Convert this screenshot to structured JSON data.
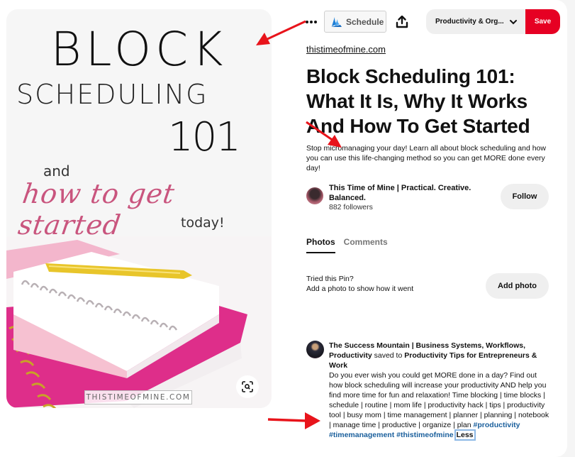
{
  "pin_image": {
    "title_line1": "BLOCK",
    "title_line2": "SCHEDULING",
    "title_line3": "101",
    "subtitle_and": "and",
    "subtitle_script": "how to get started",
    "subtitle_today": "today!",
    "watermark": "THISTIMEOFMINE.COM",
    "lens_icon": "visual-search-icon"
  },
  "toolbar": {
    "more_icon": "ellipsis-icon",
    "schedule_label": "Schedule",
    "share_icon": "share-upload-icon",
    "board_select_value": "Productivity & Org...",
    "save_label": "Save",
    "save_color": "#e60023"
  },
  "pin": {
    "source_link": "thistimeofmine.com",
    "title": "Block Scheduling 101: What It Is, Why It Works And How To Get Started",
    "description": "Stop micromanaging your day! Learn all about block scheduling and how you can use this life-changing method so you can get MORE done every day!"
  },
  "creator": {
    "name": "This Time of Mine | Practical. Creative. Balanced.",
    "followers": "882 followers",
    "follow_label": "Follow"
  },
  "tabs": [
    {
      "label": "Photos",
      "active": true
    },
    {
      "label": "Comments",
      "active": false
    }
  ],
  "tried": {
    "line1": "Tried this Pin?",
    "line2": "Add a photo to show how it went",
    "button_label": "Add photo"
  },
  "activity": {
    "user": "The Success Mountain | Business Systems, Workflows, Productivity",
    "action": "saved to",
    "board": "Productivity Tips for Entrepreneurs & Work",
    "text": "Do you ever wish you could get MORE done in a day? Find out how block scheduling will increase your productivity AND help you find more time for fun and relaxation! Time blocking | time blocks | schedule | routine | mom life | productivity hack | tips | productivity tool | busy mom | time management | planner | planning | notebook | manage time | productive | organize | plan",
    "hashtags": [
      "#productivity",
      "#timemanagement",
      "#thistimeofmine"
    ],
    "less_label": "Less",
    "hashtag_color": "#1a5f9c"
  },
  "annotations": {
    "arrow_color": "#e8141b"
  }
}
